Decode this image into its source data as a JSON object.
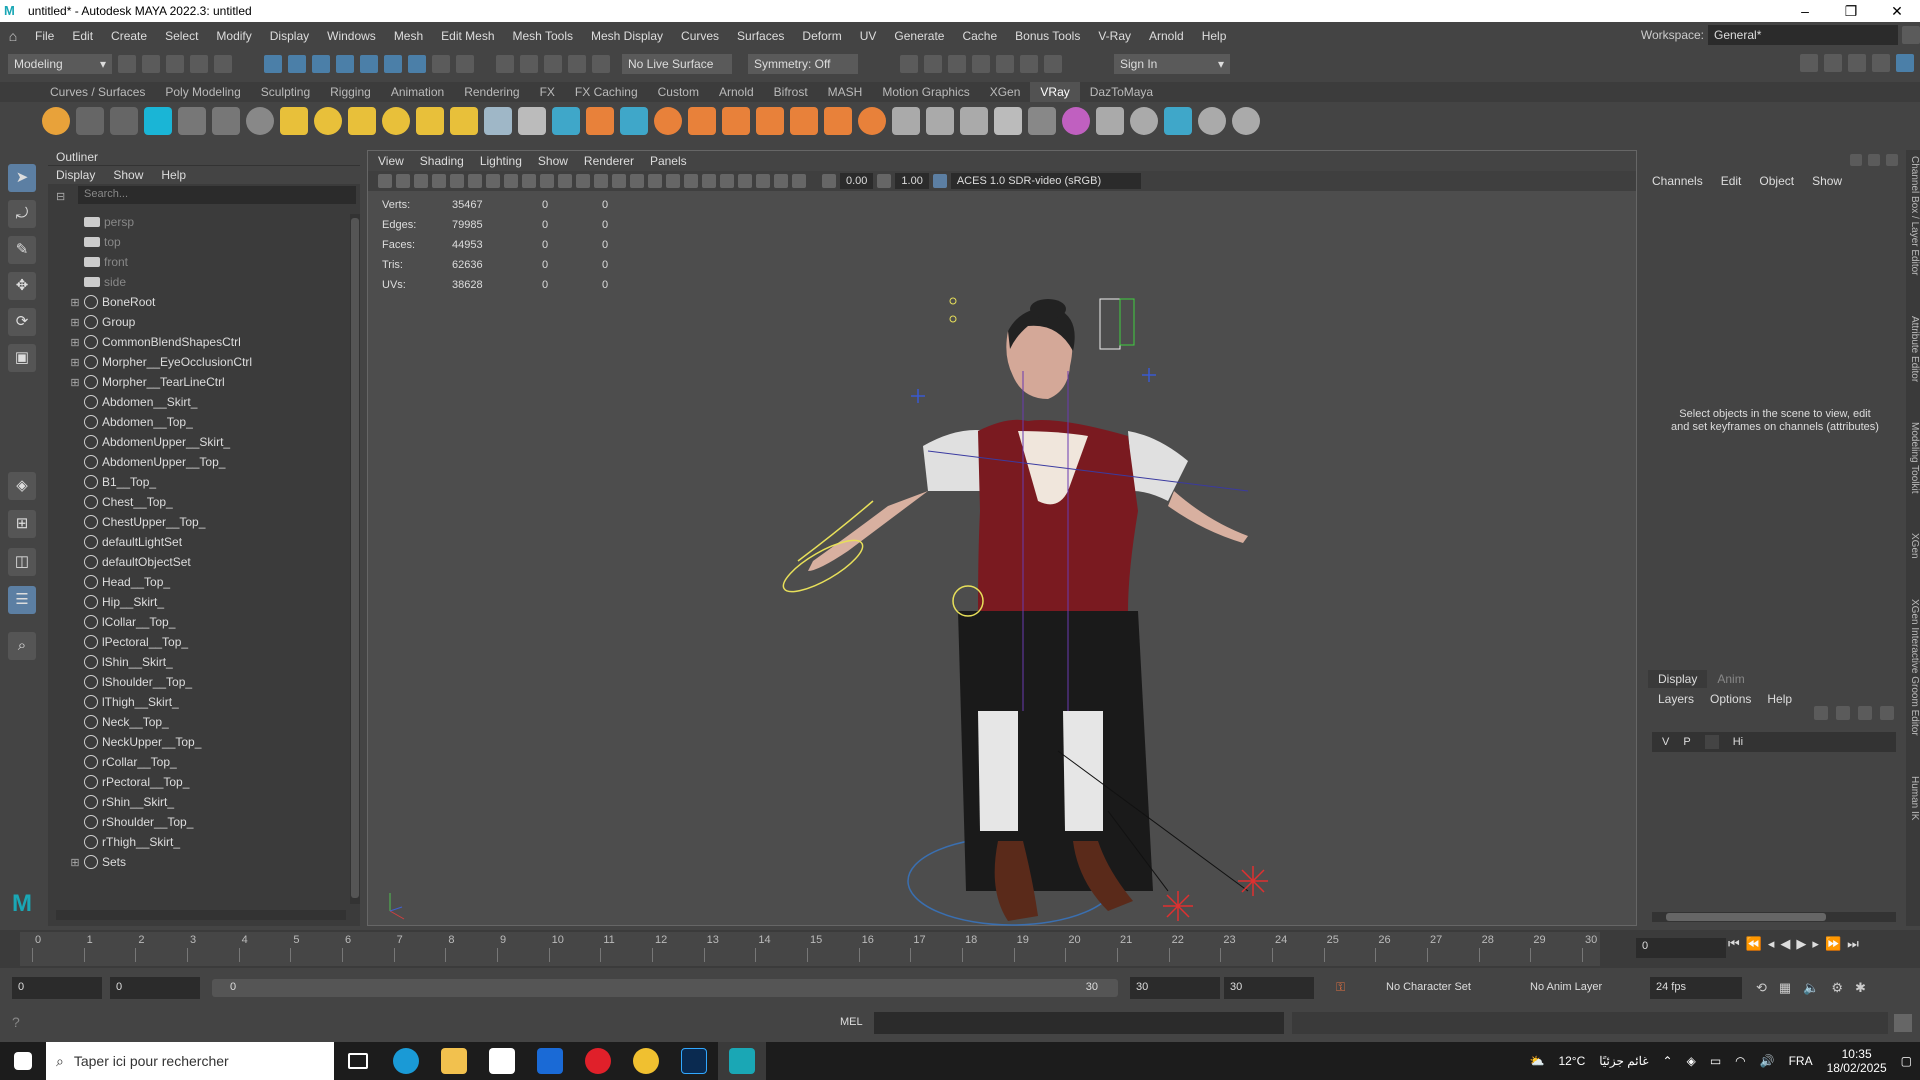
{
  "title": "untitled* - Autodesk MAYA 2022.3: untitled",
  "menus": [
    "File",
    "Edit",
    "Create",
    "Select",
    "Modify",
    "Display",
    "Windows",
    "Mesh",
    "Edit Mesh",
    "Mesh Tools",
    "Mesh Display",
    "Curves",
    "Surfaces",
    "Deform",
    "UV",
    "Generate",
    "Cache",
    "Bonus Tools",
    "V-Ray",
    "Arnold",
    "Help"
  ],
  "workspace": {
    "label": "Workspace:",
    "value": "General*"
  },
  "status": {
    "mode": "Modeling",
    "live": "No Live Surface",
    "symmetry": "Symmetry: Off",
    "signin": "Sign In"
  },
  "shelf_tabs": [
    "Curves / Surfaces",
    "Poly Modeling",
    "Sculpting",
    "Rigging",
    "Animation",
    "Rendering",
    "FX",
    "FX Caching",
    "Custom",
    "Arnold",
    "Bifrost",
    "MASH",
    "Motion Graphics",
    "XGen",
    "VRay",
    "DazToMaya"
  ],
  "shelf_active": "VRay",
  "outliner": {
    "title": "Outliner",
    "menu": [
      "Display",
      "Show",
      "Help"
    ],
    "search": "Search...",
    "items": [
      {
        "label": "persp",
        "type": "cam"
      },
      {
        "label": "top",
        "type": "cam"
      },
      {
        "label": "front",
        "type": "cam"
      },
      {
        "label": "side",
        "type": "cam"
      },
      {
        "label": "BoneRoot",
        "type": "grp"
      },
      {
        "label": "Group",
        "type": "grp"
      },
      {
        "label": "CommonBlendShapesCtrl",
        "type": "grp"
      },
      {
        "label": "Morpher__EyeOcclusionCtrl",
        "type": "grp"
      },
      {
        "label": "Morpher__TearLineCtrl",
        "type": "grp"
      },
      {
        "label": "Abdomen__Skirt_",
        "type": "set"
      },
      {
        "label": "Abdomen__Top_",
        "type": "set"
      },
      {
        "label": "AbdomenUpper__Skirt_",
        "type": "set"
      },
      {
        "label": "AbdomenUpper__Top_",
        "type": "set"
      },
      {
        "label": "B1__Top_",
        "type": "set"
      },
      {
        "label": "Chest__Top_",
        "type": "set"
      },
      {
        "label": "ChestUpper__Top_",
        "type": "set"
      },
      {
        "label": "defaultLightSet",
        "type": "set"
      },
      {
        "label": "defaultObjectSet",
        "type": "set"
      },
      {
        "label": "Head__Top_",
        "type": "set"
      },
      {
        "label": "Hip__Skirt_",
        "type": "set"
      },
      {
        "label": "lCollar__Top_",
        "type": "set"
      },
      {
        "label": "lPectoral__Top_",
        "type": "set"
      },
      {
        "label": "lShin__Skirt_",
        "type": "set"
      },
      {
        "label": "lShoulder__Top_",
        "type": "set"
      },
      {
        "label": "lThigh__Skirt_",
        "type": "set"
      },
      {
        "label": "Neck__Top_",
        "type": "set"
      },
      {
        "label": "NeckUpper__Top_",
        "type": "set"
      },
      {
        "label": "rCollar__Top_",
        "type": "set"
      },
      {
        "label": "rPectoral__Top_",
        "type": "set"
      },
      {
        "label": "rShin__Skirt_",
        "type": "set"
      },
      {
        "label": "rShoulder__Top_",
        "type": "set"
      },
      {
        "label": "rThigh__Skirt_",
        "type": "set"
      },
      {
        "label": "Sets",
        "type": "grp"
      }
    ]
  },
  "viewport": {
    "menu": [
      "View",
      "Shading",
      "Lighting",
      "Show",
      "Renderer",
      "Panels"
    ],
    "gamma": "0.00",
    "exposure": "1.00",
    "colorspace": "ACES 1.0 SDR-video (sRGB)",
    "hud": [
      {
        "label": "Verts:",
        "v": "35467",
        "a": "0",
        "b": "0"
      },
      {
        "label": "Edges:",
        "v": "79985",
        "a": "0",
        "b": "0"
      },
      {
        "label": "Faces:",
        "v": "44953",
        "a": "0",
        "b": "0"
      },
      {
        "label": "Tris:",
        "v": "62636",
        "a": "0",
        "b": "0"
      },
      {
        "label": "UVs:",
        "v": "38628",
        "a": "0",
        "b": "0"
      }
    ]
  },
  "channelbox": {
    "menu": [
      "Channels",
      "Edit",
      "Object",
      "Show"
    ],
    "message": "Select objects in the scene to view, edit and set keyframes on channels (attributes)"
  },
  "layers": {
    "tabs": [
      "Display",
      "Anim"
    ],
    "menu": [
      "Layers",
      "Options",
      "Help"
    ],
    "row": {
      "v": "V",
      "p": "P",
      "name": "Hi"
    }
  },
  "side_tabs": [
    "Channel Box / Layer Editor",
    "Attribute Editor",
    "Modeling Toolkit",
    "XGen",
    "XGen Interactive Groom Editor",
    "Human IK"
  ],
  "timeline": {
    "ticks": [
      "0",
      "1",
      "2",
      "3",
      "4",
      "5",
      "6",
      "7",
      "8",
      "9",
      "10",
      "11",
      "12",
      "13",
      "14",
      "15",
      "16",
      "17",
      "18",
      "19",
      "20",
      "21",
      "22",
      "23",
      "24",
      "25",
      "26",
      "27",
      "28",
      "29",
      "30"
    ],
    "current": "0"
  },
  "range": {
    "start": "0",
    "anim_start": "0",
    "slider_start": "0",
    "slider_end": "30",
    "end": "30",
    "anim_end": "30",
    "charset": "No Character Set",
    "animlayer": "No Anim Layer",
    "fps": "24 fps"
  },
  "cmdline": {
    "lang": "MEL"
  },
  "taskbar": {
    "search": "Taper ici pour rechercher",
    "weather": "12°C",
    "weather_text": "غائم جزئيًا",
    "lang": "FRA",
    "time": "10:35",
    "date": "18/02/2025"
  }
}
